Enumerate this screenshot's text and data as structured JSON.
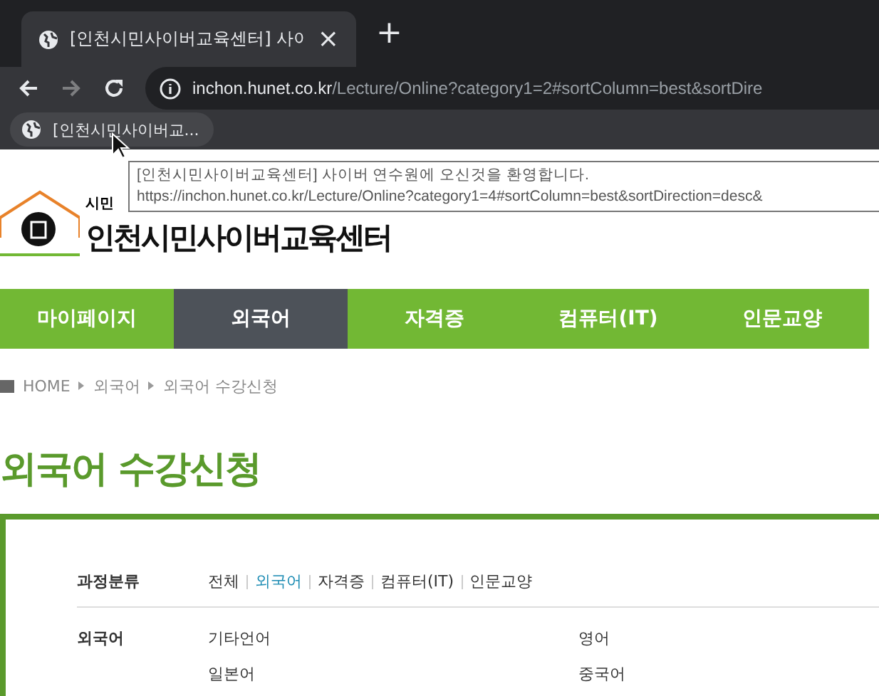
{
  "browser": {
    "tab": {
      "title": "[인천시민사이버교육센터] 사이",
      "close": "×"
    },
    "new_tab": "+",
    "address": {
      "host": "inchon.hunet.co.kr",
      "path": "/Lecture/Online?category1=2#sortColumn=best&sortDire"
    },
    "bookmark": {
      "label": "[인천시민사이버교..."
    },
    "tooltip": {
      "lines": [
        "[인천시민사이버교육센터] 사이버 연수원에 오신것을 환영합니다.",
        "https://inchon.hunet.co.kr/Lecture/Online?category1=4#sortColumn=best&sortDirection=desc&"
      ]
    }
  },
  "logo": {
    "small": "시민",
    "name": "인천시민사이버교육센터"
  },
  "nav": [
    {
      "label": "마이페이지",
      "selected": false
    },
    {
      "label": "외국어",
      "selected": true
    },
    {
      "label": "자격증",
      "selected": false
    },
    {
      "label": "컴퓨터(IT)",
      "selected": false
    },
    {
      "label": "인문교양",
      "selected": false
    }
  ],
  "breadcrumb": [
    "HOME",
    "외국어",
    "외국어 수강신청"
  ],
  "page_title": "외국어 수강신청",
  "filter": {
    "label": "과정분류",
    "options": [
      {
        "label": "전체",
        "selected": false
      },
      {
        "label": "외국어",
        "selected": true
      },
      {
        "label": "자격증",
        "selected": false
      },
      {
        "label": "컴퓨터(IT)",
        "selected": false
      },
      {
        "label": "인문교양",
        "selected": false
      }
    ]
  },
  "subcategory": {
    "label": "외국어",
    "items": [
      "기타언어",
      "영어",
      "일본어",
      "중국어"
    ]
  }
}
